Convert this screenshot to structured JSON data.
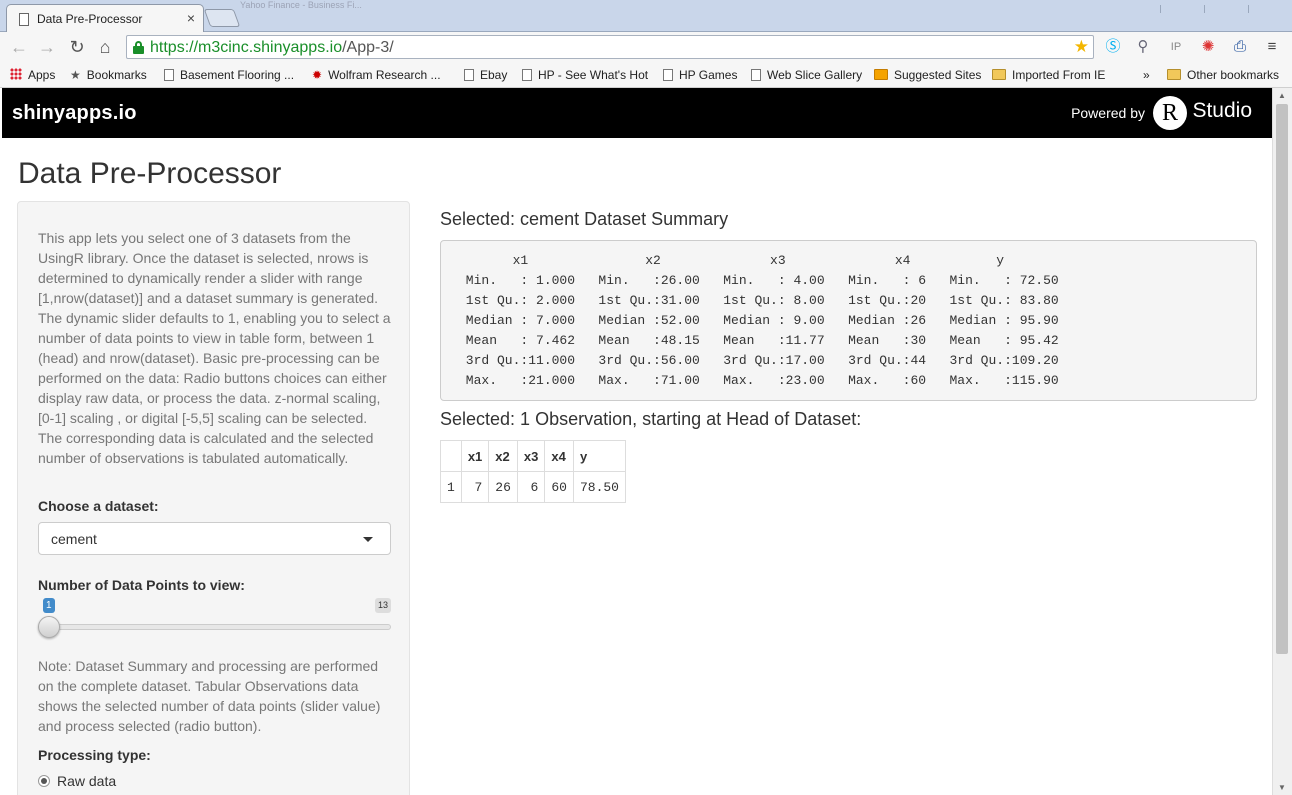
{
  "browser": {
    "tab_title": "Data Pre-Processor",
    "tab_close": "×",
    "url_scheme_host": "https://m3cinc.shinyapps.io",
    "url_path": "/App-3/",
    "background_tabs": "Yahoo Finance - Business Fi...",
    "bookmarks": [
      {
        "label": "Apps",
        "icon": "apps-icon"
      },
      {
        "label": "Bookmarks",
        "icon": "star-icon"
      },
      {
        "label": "Basement Flooring ...",
        "icon": "page-icon"
      },
      {
        "label": "Wolfram Research ...",
        "icon": "wolfram-icon"
      },
      {
        "label": "Ebay",
        "icon": "page-icon"
      },
      {
        "label": "HP - See What's Hot",
        "icon": "page-icon"
      },
      {
        "label": "HP Games",
        "icon": "page-icon"
      },
      {
        "label": "Web Slice Gallery",
        "icon": "page-icon"
      },
      {
        "label": "Suggested Sites",
        "icon": "suggested-icon"
      },
      {
        "label": "Imported From IE",
        "icon": "folder-icon"
      }
    ],
    "bookmarks_overflow": "»",
    "other_bookmarks": "Other bookmarks"
  },
  "navbar": {
    "brand": "shinyapps.io",
    "powered_by": "Powered by",
    "r_letter": "R",
    "studio": "Studio",
    "color": "#000000"
  },
  "page": {
    "title": "Data Pre-Processor"
  },
  "sidebar": {
    "intro": "This app lets you select one of 3 datasets from the UsingR library. Once the dataset is selected, nrows is determined to dynamically render a slider with range [1,nrow(dataset)] and a dataset summary is generated. The dynamic slider defaults to 1, enabling you to select a number of data points to view in table form, between 1 (head) and nrow(dataset). Basic pre-processing can be performed on the data: Radio buttons choices can either display raw data, or process the data. z-normal scaling, [0-1] scaling , or digital [-5,5] scaling can be selected. The corresponding data is calculated and the selected number of observations is tabulated automatically.",
    "dataset_label": "Choose a dataset:",
    "dataset_value": "cement",
    "slider_label": "Number of Data Points to view:",
    "slider_min": "1",
    "slider_max": "13",
    "slider_value": "1",
    "note": "Note: Dataset Summary and processing are performed on the complete dataset. Tabular Observations data shows the selected number of data points (slider value) and process selected (radio button).",
    "processing_label": "Processing type:",
    "radio_option": "Raw data"
  },
  "main": {
    "summary_heading": "Selected: cement Dataset Summary",
    "summary_lines": [
      "       x1               x2              x3              x4           y         ",
      " Min.   : 1.000   Min.   :26.00   Min.   : 4.00   Min.   : 6   Min.   : 72.50  ",
      " 1st Qu.: 2.000   1st Qu.:31.00   1st Qu.: 8.00   1st Qu.:20   1st Qu.: 83.80  ",
      " Median : 7.000   Median :52.00   Median : 9.00   Median :26   Median : 95.90  ",
      " Mean   : 7.462   Mean   :48.15   Mean   :11.77   Mean   :30   Mean   : 95.42  ",
      " 3rd Qu.:11.000   3rd Qu.:56.00   3rd Qu.:17.00   3rd Qu.:44   3rd Qu.:109.20  ",
      " Max.   :21.000   Max.   :71.00   Max.   :23.00   Max.   :60   Max.   :115.90  "
    ],
    "obs_heading": "Selected: 1 Observation, starting at Head of Dataset:",
    "table": {
      "headers": [
        "",
        "x1",
        "x2",
        "x3",
        "x4",
        "y"
      ],
      "rows": [
        [
          "1",
          "7",
          "26",
          "6",
          "60",
          "78.50"
        ]
      ]
    }
  }
}
